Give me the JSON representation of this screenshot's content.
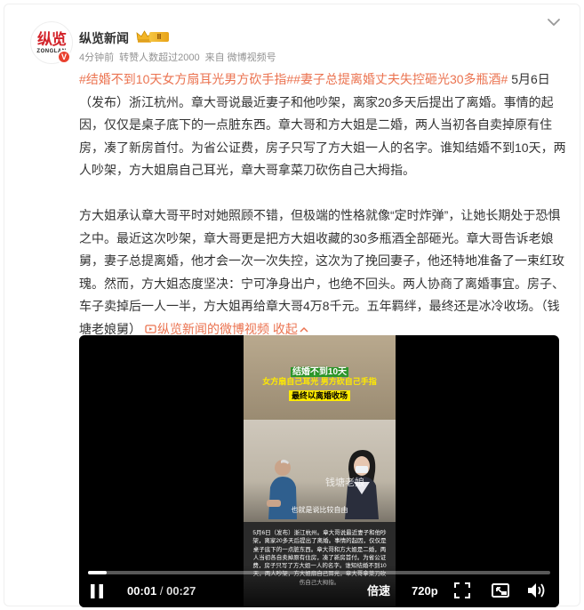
{
  "user": {
    "avatar_cn": "纵览",
    "avatar_en": "ZONGLAN",
    "verified_mark": "V",
    "name": "纵览新闻",
    "level": "II",
    "time": "4分钟前",
    "reposts": "转赞人数超过2000",
    "source": "来自 微博视频号"
  },
  "post": {
    "tag1": "#结婚不到10天女方扇耳光男方砍手指#",
    "tag2": "#妻子总提离婚丈夫失控砸光30多瓶酒#",
    "p1_rest_line1": " 5月",
    "p1_body": "6日（发布）浙江杭州。章大哥说最近妻子和他吵架，离家20多天后提出了离婚。事情的起因，仅仅是桌子底下的一点脏东西。章大哥和方大姐是二婚，两人当初各自卖掉原有住房，凑了新房首付。为省公证费，房子只写了方大姐一人的名字。谁知结婚不到10天，两人吵架，方大姐扇自己耳光，章大哥拿菜刀砍伤自己大拇指。",
    "p2_body": "方大姐承认章大哥平时对她照顾不错，但极端的性格就像“定时炸弹”，让她长期处于恐惧之中。最近这次吵架，章大哥更是把方大姐收藏的30多瓶酒全部砸光。章大哥告诉老娘舅，妻子总提离婚，他才会一次一次失控，这次为了挽回妻子，他还特地准备了一束红玫瑰。然而，方大姐态度坚决：宁可净身出户，也绝不回头。两人协商了离婚事宜。房子、车子卖掉后一人一半，方大姐再给章大哥4万8千元。五年羁绊，最终还是冰冷收场。（钱塘老娘舅）",
    "video_link": "纵览新闻的微博视频",
    "collapse": "收起"
  },
  "video": {
    "overlay_title1": "结婚不到10天",
    "overlay_title2": "女方扇自己耳光 男方砍自己手指",
    "overlay_title3": "最终以离婚收场",
    "watermark": "钱塘老娘",
    "subtitle": "也就是说比较自由",
    "bottom_text": "5月6日（发布）浙江杭州。章大哥说最近妻子和他吵架，离家20多天后提出了离婚。事情的起因，仅仅是桌子底下的一点脏东西。章大哥和方大姐是二婚，两人当初各自卖掉原有住房，凑了新房首付。为省公证费，房子只写了方大姐一人的名字。谁知结婚不到10天，两人吵架，方大姐扇自己耳光，章大哥拿菜刀砍伤自己大拇指。",
    "current_time": "00:01",
    "separator": " / ",
    "duration": "00:27",
    "progress": 0.04,
    "speed_label": "倍速",
    "quality_label": "720p",
    "icons": [
      "pause-icon",
      "fullscreen-icon",
      "pip-icon",
      "volume-icon",
      "crown-icon",
      "chevron-down-icon",
      "video-link-icon",
      "chevron-up-icon"
    ]
  },
  "colors": {
    "accent": "#eb7350",
    "verified": "#e9412f",
    "logo_red": "#d3232a"
  }
}
